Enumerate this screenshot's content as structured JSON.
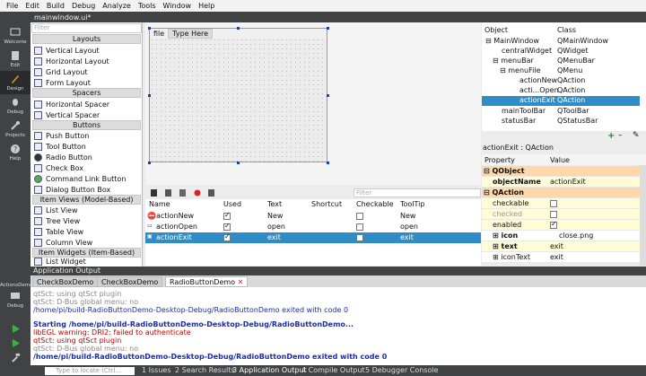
{
  "menu": [
    "File",
    "Edit",
    "Build",
    "Debug",
    "Analyze",
    "Tools",
    "Window",
    "Help"
  ],
  "modes": [
    "Welcome",
    "Edit",
    "Design",
    "Debug",
    "Projects",
    "Help"
  ],
  "doc_tab": "mainwindow.ui*",
  "widgetbox": {
    "filter_placeholder": "Filter",
    "layouts_title": "Layouts",
    "layouts": [
      "Vertical Layout",
      "Horizontal Layout",
      "Grid Layout",
      "Form Layout"
    ],
    "spacers_title": "Spacers",
    "spacers": [
      "Horizontal Spacer",
      "Vertical Spacer"
    ],
    "buttons_title": "Buttons",
    "buttons": [
      "Push Button",
      "Tool Button",
      "Radio Button",
      "Check Box",
      "Command Link Button",
      "Dialog Button Box"
    ],
    "itemviews_title": "Item Views (Model-Based)",
    "itemviews": [
      "List View",
      "Tree View",
      "Table View",
      "Column View"
    ],
    "itemwidgets_title": "Item Widgets (Item-Based)",
    "itemwidgets": [
      "List Widget"
    ]
  },
  "form": {
    "menu1": "file",
    "menu2": "Type Here"
  },
  "action_editor": {
    "filter_placeholder": "Filter",
    "headers": [
      "Name",
      "Used",
      "Text",
      "Shortcut",
      "Checkable",
      "ToolTip"
    ],
    "rows": [
      {
        "name": "actionNew",
        "text": "New",
        "tooltip": "New",
        "used": true,
        "checkable": false
      },
      {
        "name": "actionOpen",
        "text": "open",
        "tooltip": "open",
        "used": true,
        "checkable": false
      },
      {
        "name": "actionExit",
        "text": "exit",
        "tooltip": "exit",
        "used": true,
        "checkable": false
      }
    ]
  },
  "object_inspector": {
    "headers": [
      "Object",
      "Class"
    ],
    "rows": [
      {
        "object": "MainWindow",
        "class": "QMainWindow"
      },
      {
        "object": "centralWidget",
        "class": "QWidget"
      },
      {
        "object": "menuBar",
        "class": "QMenuBar"
      },
      {
        "object": "menuFile",
        "class": "QMenu"
      },
      {
        "object": "actionNew",
        "class": "QAction"
      },
      {
        "object": "acti...Open",
        "class": "QAction"
      },
      {
        "object": "actionExit",
        "class": "QAction"
      },
      {
        "object": "mainToolBar",
        "class": "QToolBar"
      },
      {
        "object": "statusBar",
        "class": "QStatusBar"
      }
    ]
  },
  "property_editor": {
    "object_label": "actionExit : QAction",
    "headers": [
      "Property",
      "Value"
    ],
    "rows": [
      {
        "k": "QObject",
        "v": ""
      },
      {
        "k": "objectName",
        "v": "actionExit"
      },
      {
        "k": "QAction",
        "v": ""
      },
      {
        "k": "checkable",
        "v": ""
      },
      {
        "k": "checked",
        "v": ""
      },
      {
        "k": "enabled",
        "v": ""
      },
      {
        "k": "icon",
        "v": "close.png"
      },
      {
        "k": "text",
        "v": "exit"
      },
      {
        "k": "iconText",
        "v": "exit"
      }
    ]
  },
  "output": {
    "title": "Application Output",
    "tabs": [
      "CheckBoxDemo",
      "CheckBoxDemo",
      "RadioButtonDemo"
    ],
    "lines": [
      "qtSct: using qtSct plugin",
      "qtSct: D-Bus global menu: no",
      "/home/pi/build-RadioButtonDemo-Desktop-Debug/RadioButtonDemo exited with code 0",
      "",
      "Starting /home/pi/build-RadioButtonDemo-Desktop-Debug/RadioButtonDemo...",
      "libEGL warning: DRI2: failed to authenticate",
      "qtSct: using qtSct plugin",
      "qtSct: D-Bus global menu: no",
      "/home/pi/build-RadioButtonDemo-Desktop-Debug/RadioButtonDemo exited with code 0"
    ]
  },
  "left_lower": {
    "project": "ActionsDemo",
    "mode": "Debug"
  },
  "status": {
    "locate_placeholder": "Type to locate (Ctrl...",
    "panes": [
      "1 Issues",
      "2 Search Results",
      "3 Application Output",
      "4 Compile Output",
      "5 Debugger Console"
    ]
  }
}
